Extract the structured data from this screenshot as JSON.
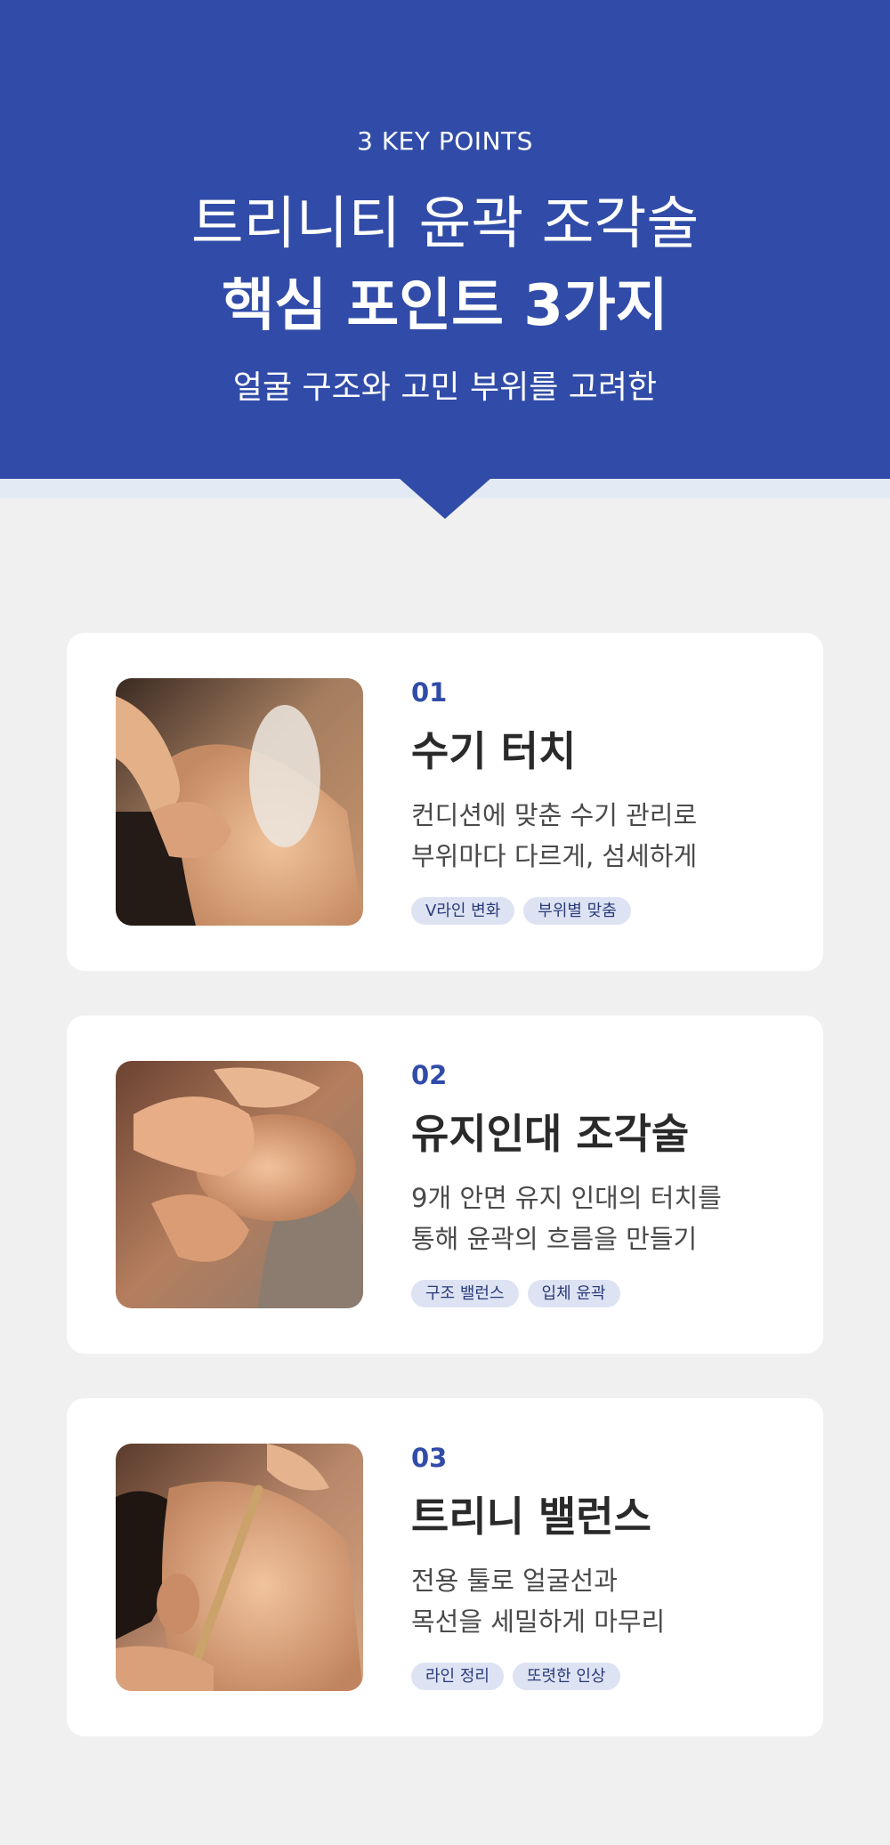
{
  "hero": {
    "kicker": "3 KEY POINTS",
    "headline_line1": "트리니티 윤곽 조각술",
    "headline_line2": "핵심 포인트 3가지",
    "subtitle": "얼굴 구조와 고민 부위를 고려한",
    "colors": {
      "background": "#314ca8",
      "divider": "#e4eaf3",
      "text": "#ffffff"
    }
  },
  "cards": [
    {
      "number": "01",
      "title": "수기 터치",
      "desc_line1": "컨디션에 맞춘 수기 관리로",
      "desc_line2": "부위마다 다르게, 섬세하게",
      "tags": [
        "V라인 변화",
        "부위별 맞춤"
      ]
    },
    {
      "number": "02",
      "title": "유지인대 조각술",
      "desc_line1": "9개 안면 유지 인대의 터치를",
      "desc_line2": "통해 윤곽의 흐름을 만들기",
      "tags": [
        "구조 밸런스",
        "입체 윤곽"
      ]
    },
    {
      "number": "03",
      "title": "트리니 밸런스",
      "desc_line1": "전용 툴로 얼굴선과",
      "desc_line2": "목선을 세밀하게 마무리",
      "tags": [
        "라인 정리",
        "또렷한 인상"
      ]
    }
  ],
  "theme": {
    "accent": "#314ca8",
    "tag_bg": "#dde3f3",
    "tag_text": "#2b3b78",
    "page_bg": "#f0f0f0"
  }
}
